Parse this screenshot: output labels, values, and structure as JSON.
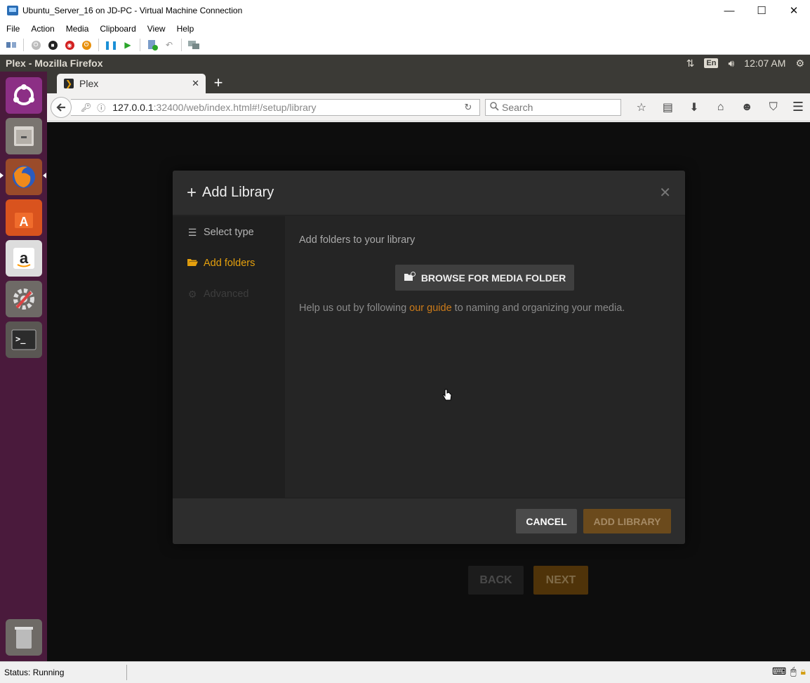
{
  "vm_window": {
    "title": "Ubuntu_Server_16 on JD-PC - Virtual Machine Connection",
    "controls": [
      "—",
      "☐",
      "✕"
    ],
    "menu": [
      "File",
      "Action",
      "Media",
      "Clipboard",
      "View",
      "Help"
    ],
    "status": "Status: Running"
  },
  "ubuntu": {
    "panel_title": "Plex - Mozilla Firefox",
    "keyboard_layout": "En",
    "clock": "12:07 AM"
  },
  "firefox": {
    "tab_label": "Plex",
    "url_host": "127.0.0.1",
    "url_rest": ":32400/web/index.html#!/setup/library",
    "search_placeholder": "Search"
  },
  "plex": {
    "back_label": "BACK",
    "next_label": "NEXT",
    "modal": {
      "title": "Add Library",
      "steps": [
        {
          "label": "Select type",
          "state": "done"
        },
        {
          "label": "Add folders",
          "state": "active"
        },
        {
          "label": "Advanced",
          "state": "disabled"
        }
      ],
      "heading": "Add folders to your library",
      "browse_label": "BROWSE FOR MEDIA FOLDER",
      "help_prefix": "Help us out by following ",
      "help_link": "our guide",
      "help_suffix": " to naming and organizing your media.",
      "cancel_label": "CANCEL",
      "add_label": "ADD LIBRARY"
    }
  },
  "colors": {
    "plex_accent": "#e5a00d",
    "launcher_bg": "#4a1a3c",
    "panel_bg": "#3b3a36"
  }
}
